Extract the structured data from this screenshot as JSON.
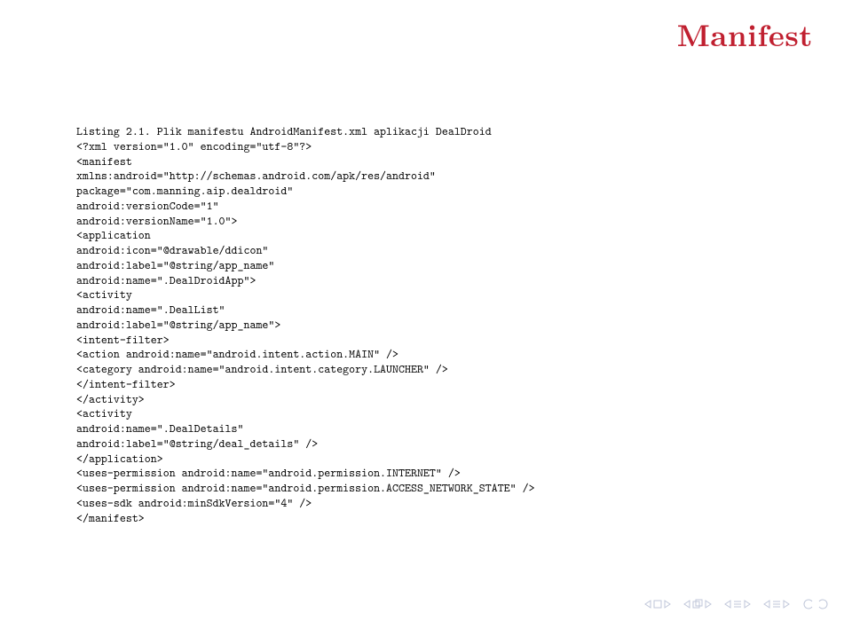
{
  "title": "Manifest",
  "listing_caption": "Listing 2.1. Plik manifestu AndroidManifest.xml aplikacji DealDroid",
  "code_lines": [
    "<?xml version=\"1.0\" encoding=\"utf-8\"?>",
    "<manifest",
    "xmlns:android=\"http://schemas.android.com/apk/res/android\"",
    "package=\"com.manning.aip.dealdroid\"",
    "android:versionCode=\"1\"",
    "android:versionName=\"1.0\">",
    "<application",
    "android:icon=\"@drawable/ddicon\"",
    "android:label=\"@string/app_name\"",
    "android:name=\".DealDroidApp\">",
    "<activity",
    "android:name=\".DealList\"",
    "android:label=\"@string/app_name\">",
    "<intent-filter>",
    "<action android:name=\"android.intent.action.MAIN\" />",
    "<category android:name=\"android.intent.category.LAUNCHER\" />",
    "</intent-filter>",
    "</activity>",
    "<activity",
    "android:name=\".DealDetails\"",
    "android:label=\"@string/deal_details\" />",
    "</application>",
    "<uses-permission android:name=\"android.permission.INTERNET\" />",
    "<uses-permission android:name=\"android.permission.ACCESS_NETWORK_STATE\" />",
    "<uses-sdk android:minSdkVersion=\"4\" />",
    "</manifest>"
  ],
  "nav": {
    "first": "first-slide",
    "prev": "previous-slide",
    "next": "next-slide",
    "last": "last-slide",
    "back": "back",
    "forward": "forward",
    "refresh": "refresh"
  }
}
